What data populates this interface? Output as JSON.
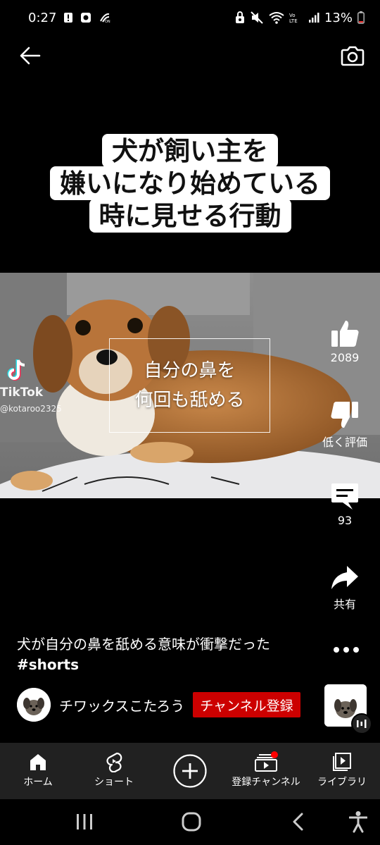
{
  "status_bar": {
    "time": "0:27",
    "battery": "13%",
    "left_icons": [
      "alert-icon",
      "recording-icon",
      "nfc-icon"
    ],
    "right_icons": [
      "lock-icon",
      "mute-icon",
      "wifi-icon",
      "volte-icon",
      "signal-icon",
      "battery-icon"
    ]
  },
  "top_bar": {
    "back_icon": "arrow-left-icon",
    "camera_icon": "camera-icon"
  },
  "video": {
    "title_lines": [
      "犬が飼い主を",
      "嫌いになり始めている",
      "時に見せる行動"
    ],
    "caption_lines": [
      "自分の鼻を",
      "何回も舐める"
    ],
    "watermark_name": "TikTok",
    "watermark_user": "@kotaroo2325"
  },
  "actions": {
    "like_count": "2089",
    "dislike_label": "低く評価",
    "comment_count": "93",
    "share_label": "共有"
  },
  "info": {
    "title_text": "犬が自分の鼻を舐める意味が衝撃だった",
    "hashtag": "#shorts",
    "channel_name": "チワックスこたろう",
    "subscribe_label": "チャンネル登録"
  },
  "bottom_nav": {
    "home": "ホーム",
    "shorts": "ショート",
    "subscriptions": "登録チャンネル",
    "library": "ライブラリ"
  },
  "colors": {
    "subscribe_red": "#cc0000",
    "notification_dot": "#ff0000",
    "nav_bg": "#212121"
  }
}
